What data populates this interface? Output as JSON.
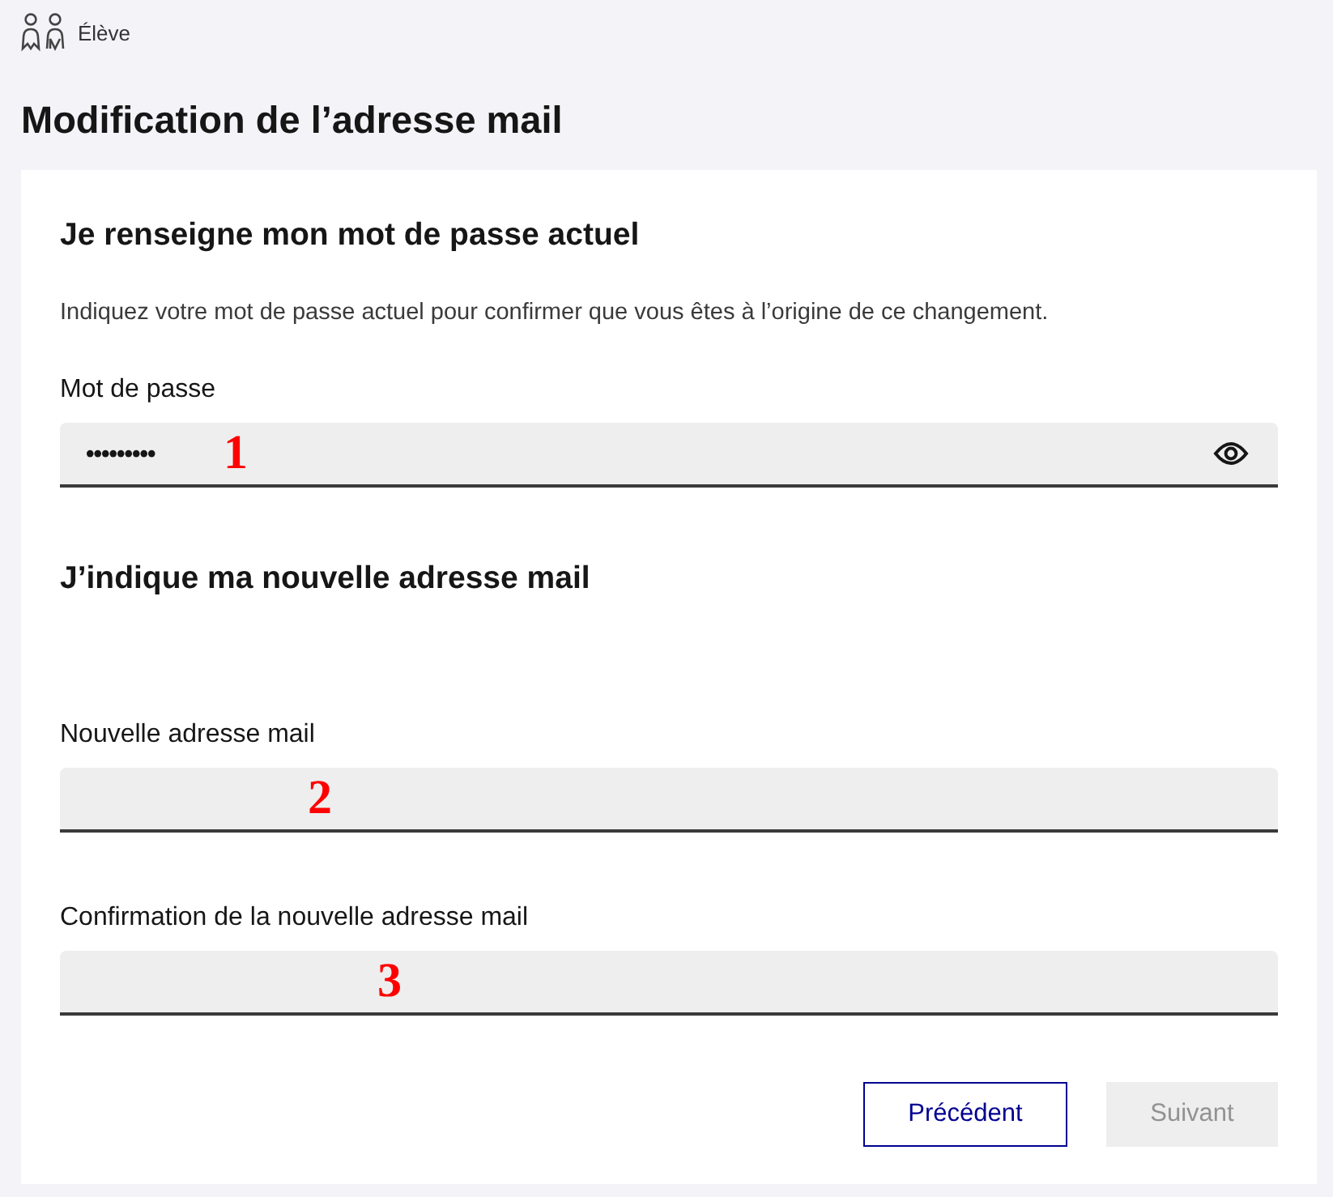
{
  "breadcrumb": {
    "label": "Élève"
  },
  "page_title": "Modification de l’adresse mail",
  "sections": [
    {
      "heading": "Je renseigne mon mot de passe actuel",
      "description": "Indiquez votre mot de passe actuel pour confirmer que vous êtes à l’origine de ce changement.",
      "fields": [
        {
          "kind": "password",
          "label": "Mot de passe",
          "value": "•••••••••",
          "annotation": "1"
        }
      ]
    },
    {
      "heading": "J’indique ma nouvelle adresse mail",
      "fields": [
        {
          "kind": "email",
          "label": "Nouvelle adresse mail",
          "annotation": "2"
        },
        {
          "kind": "email",
          "label": "Confirmation de la nouvelle adresse mail",
          "annotation": "3"
        }
      ]
    }
  ],
  "buttons": [
    {
      "label": "Précédent",
      "kind": "secondary",
      "disabled": false
    },
    {
      "label": "Suivant",
      "kind": "primary",
      "disabled": true
    }
  ]
}
